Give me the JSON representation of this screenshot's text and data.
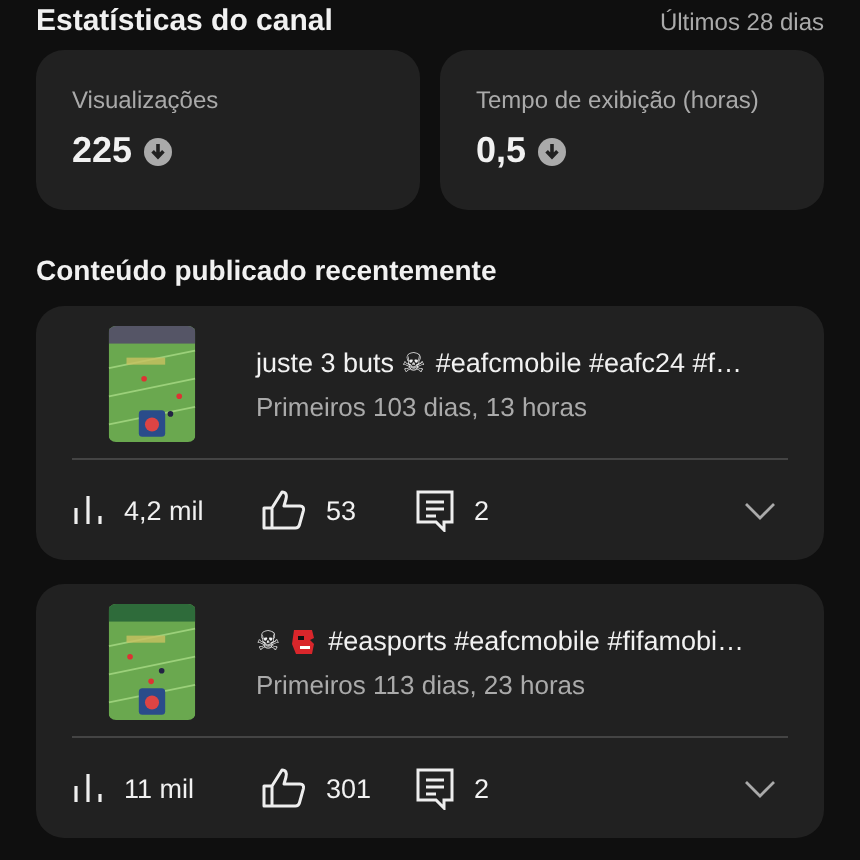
{
  "header": {
    "title": "Estatísticas do canal",
    "period": "Últimos 28 dias"
  },
  "stats": [
    {
      "label": "Visualizações",
      "value": "225",
      "declining": true
    },
    {
      "label": "Tempo de exibição (horas)",
      "value": "0,5",
      "declining": true
    }
  ],
  "section_title": "Conteúdo publicado recentemente",
  "videos": [
    {
      "title_parts": [
        {
          "kind": "text",
          "text": "juste 3 buts ☠"
        },
        {
          "kind": "text",
          "text": "#eafcmobile #eafc24 #f…"
        }
      ],
      "age": "Primeiros 103 dias, 13 horas",
      "views": "4,2 mil",
      "likes": "53",
      "comments": "2",
      "expanded": false
    },
    {
      "title_parts": [
        {
          "kind": "text",
          "text": "☠"
        },
        {
          "kind": "mask"
        },
        {
          "kind": "text",
          "text": "#easports #eafcmobile #fifamobi…"
        }
      ],
      "age": "Primeiros 113 dias, 23 horas",
      "views": "11 mil",
      "likes": "301",
      "comments": "2",
      "expanded": false
    }
  ]
}
